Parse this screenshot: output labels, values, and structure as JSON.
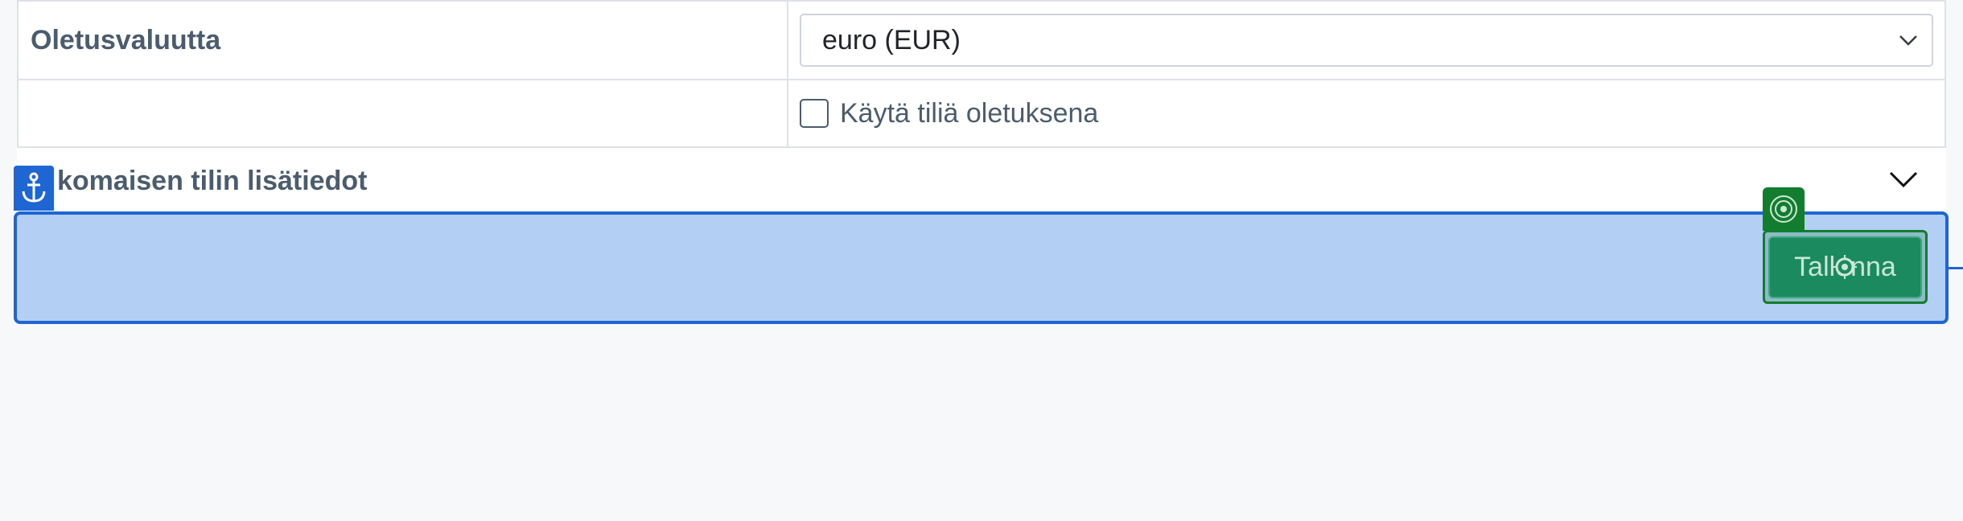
{
  "form": {
    "currency_label": "Oletusvaluutta",
    "currency_value": "euro (EUR)",
    "default_account_label": "Käytä tiliä oletuksena"
  },
  "section": {
    "title": "komaisen tilin lisätiedot"
  },
  "actions": {
    "save_label": "Tallenna"
  },
  "icons": {
    "select_chevron": "chevron-down-icon",
    "section_chevron": "chevron-down-icon",
    "anchor": "anchor-icon",
    "target": "target-icon",
    "cursor": "move-cursor-icon"
  },
  "colors": {
    "label_text": "#4a5c6e",
    "highlight_fill": "#b3d0f4",
    "highlight_border": "#1e66d4",
    "save_button": "#1b8a5f",
    "save_outline": "#127d2f"
  }
}
